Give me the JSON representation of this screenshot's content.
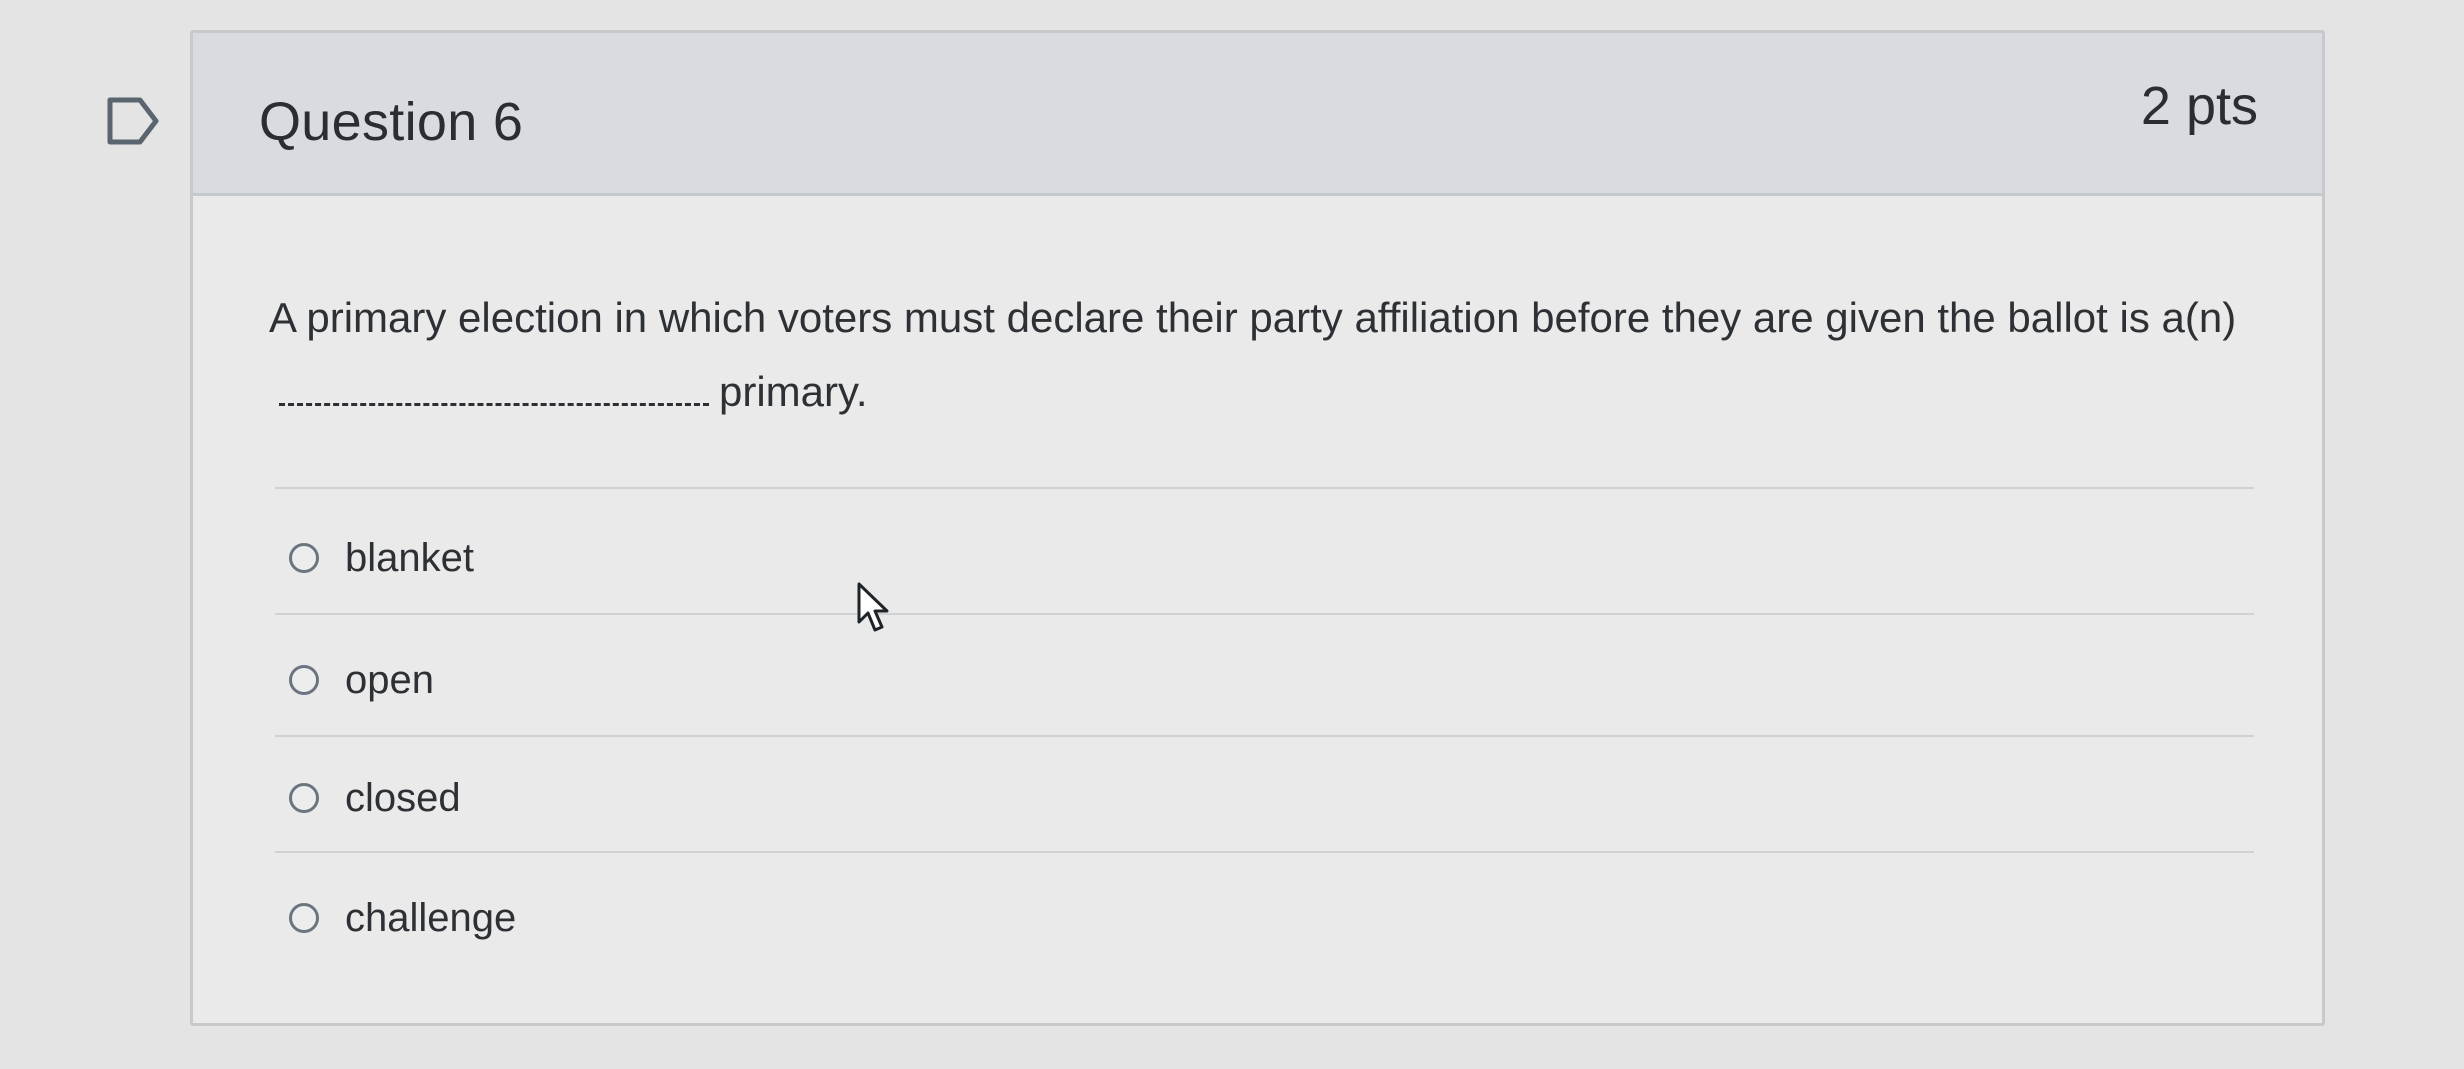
{
  "question": {
    "title": "Question 6",
    "points": "2 pts",
    "text_before_blank": "A primary election in which voters must declare their party affiliation before they are given the ballot is a(n)",
    "text_after_blank": "primary."
  },
  "answers": [
    {
      "label": "blanket",
      "selected": false
    },
    {
      "label": "open",
      "selected": false
    },
    {
      "label": "closed",
      "selected": false
    },
    {
      "label": "challenge",
      "selected": false
    }
  ],
  "colors": {
    "page_background": "#e3e4e3",
    "card_header": "#d9dbe1",
    "text": "#2d3034"
  },
  "icons": {
    "flag": "bookmark-flag-icon",
    "cursor": "mouse-pointer-icon",
    "radio": "radio-button-empty"
  }
}
